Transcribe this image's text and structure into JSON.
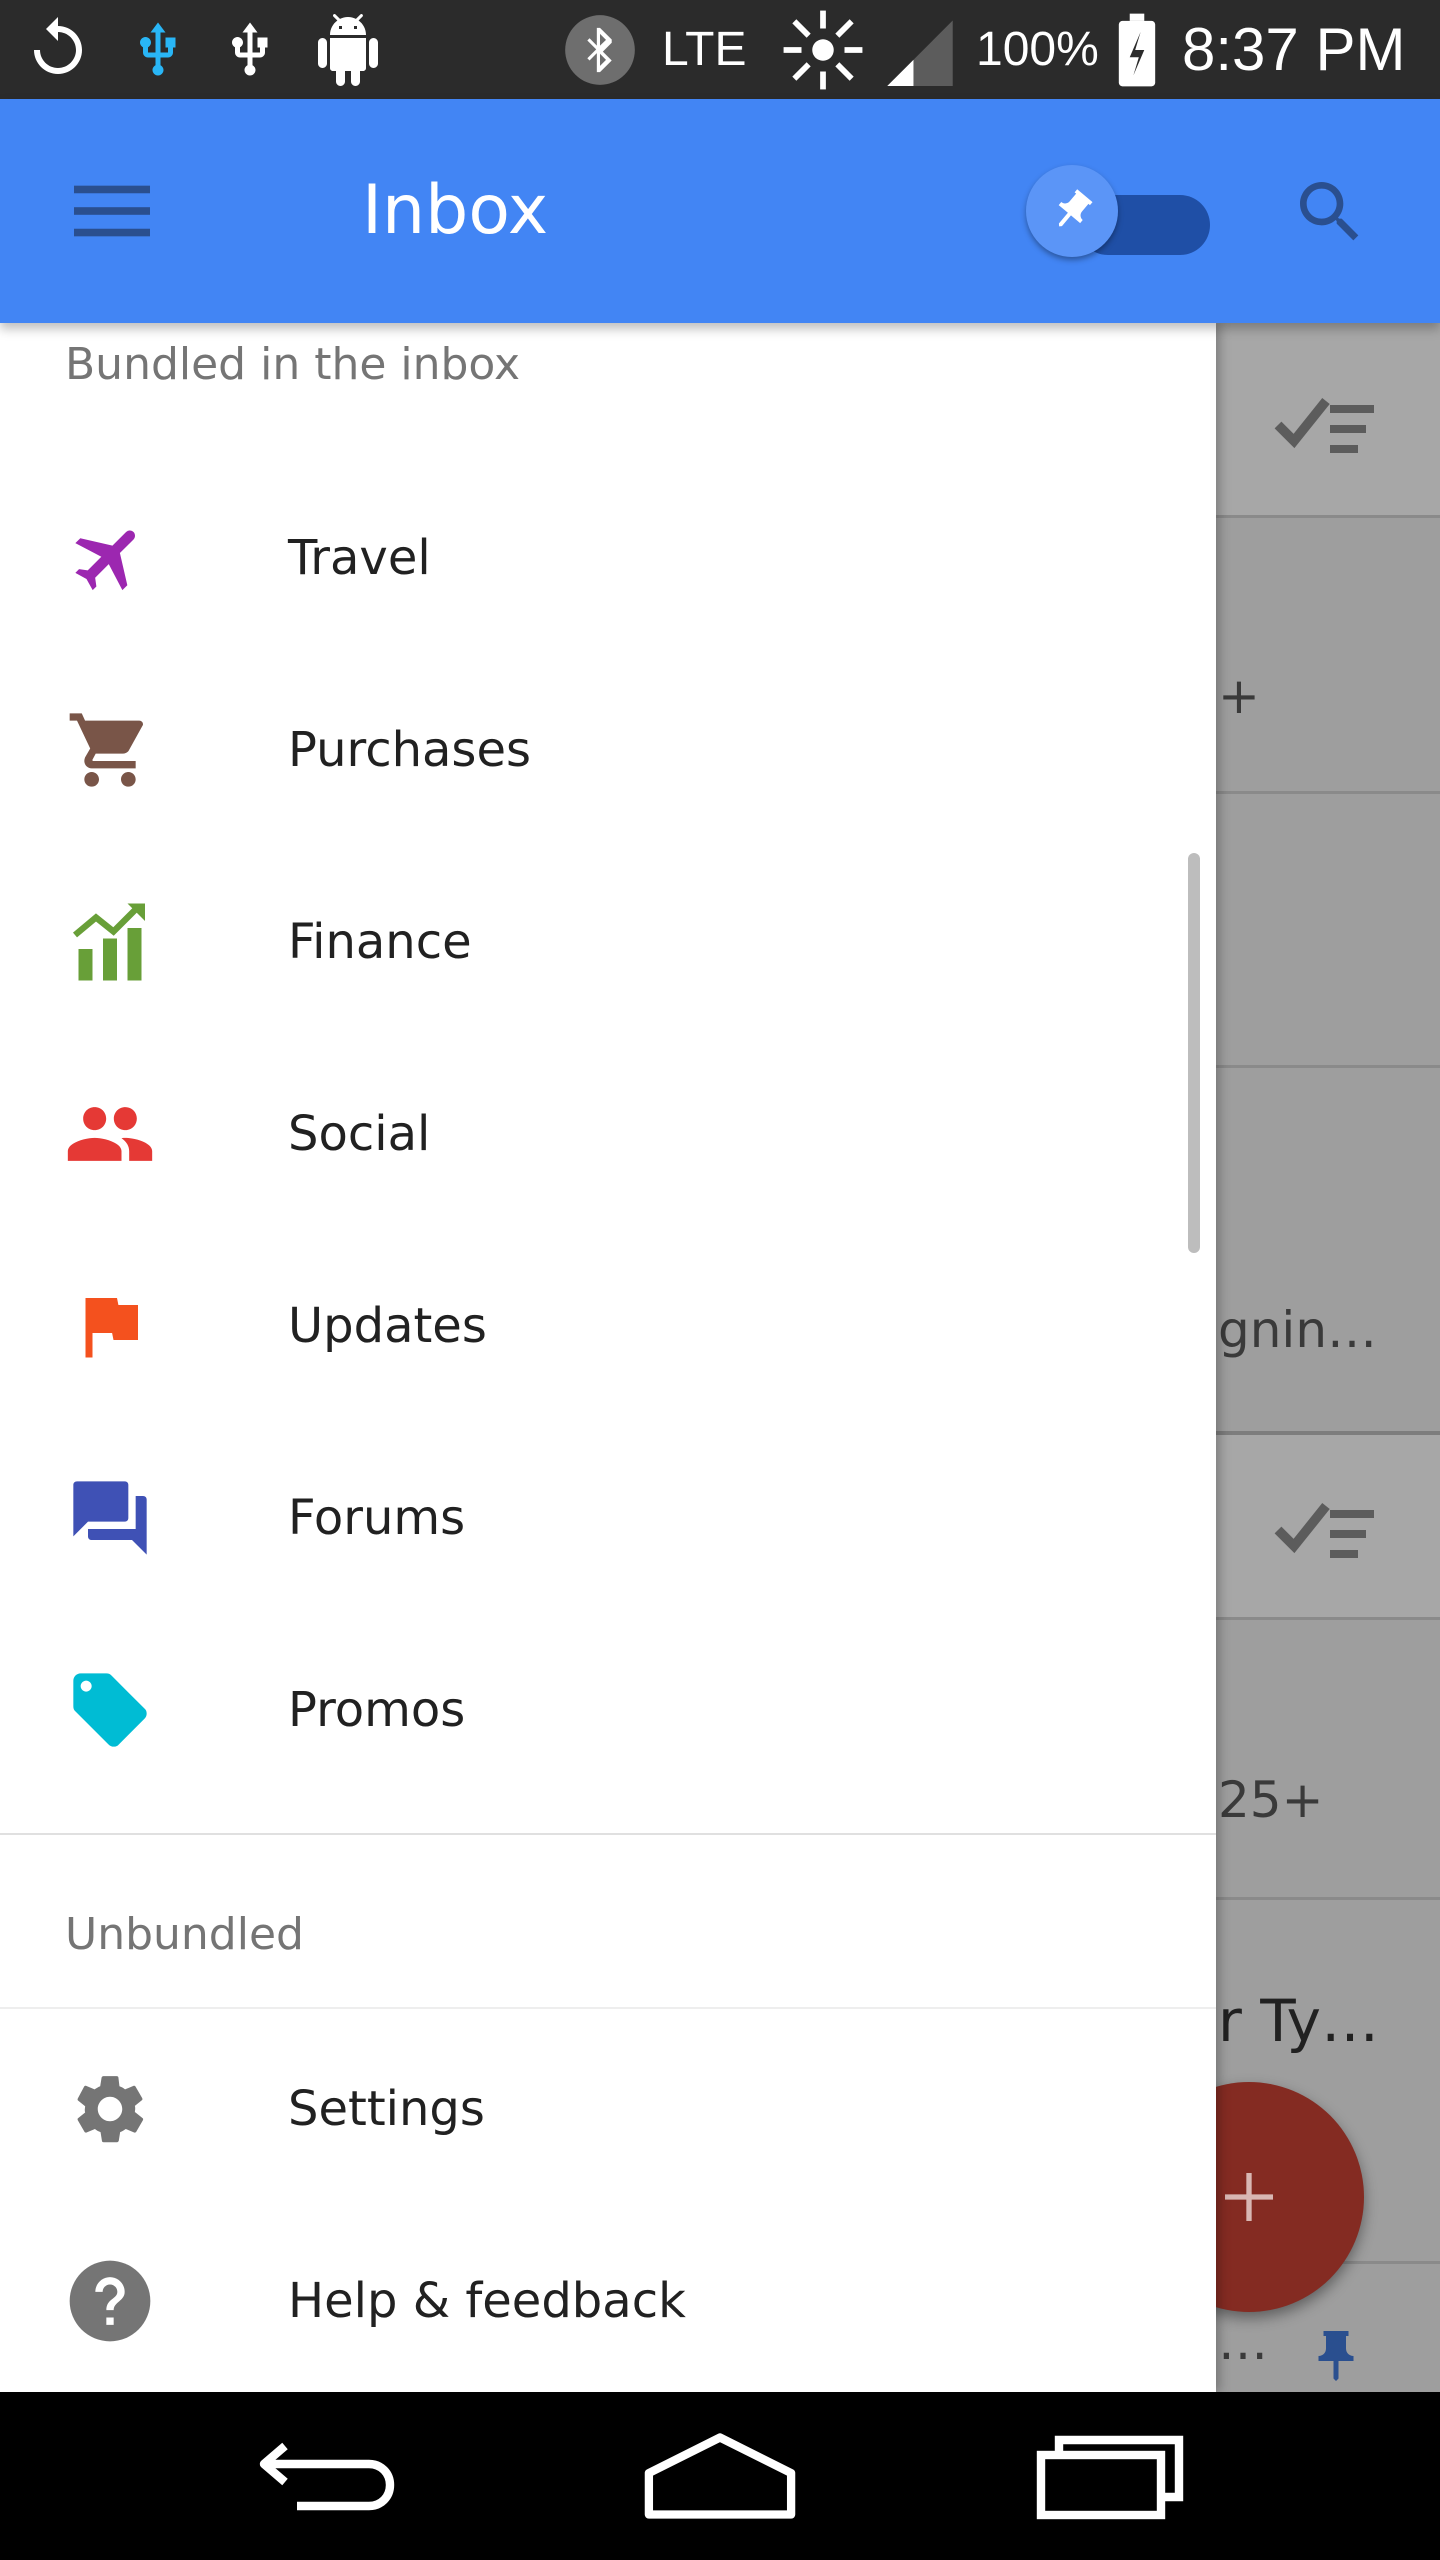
{
  "status_bar": {
    "network": "LTE",
    "battery": "100%",
    "time": "8:37 PM"
  },
  "app_bar": {
    "title": "Inbox",
    "menu_icon": "hamburger-menu-icon",
    "pin_toggle": {
      "icon": "pin-icon",
      "state": "on"
    },
    "search_icon": "search-icon",
    "color": "#4285f4"
  },
  "drawer": {
    "bundled_label": "Bundled in the inbox",
    "bundles": [
      {
        "label": "Travel",
        "icon": "airplane-icon",
        "color": "#9c27b0"
      },
      {
        "label": "Purchases",
        "icon": "cart-icon",
        "color": "#795548"
      },
      {
        "label": "Finance",
        "icon": "finance-chart-icon",
        "color": "#689f38"
      },
      {
        "label": "Social",
        "icon": "people-icon",
        "color": "#e53935"
      },
      {
        "label": "Updates",
        "icon": "flag-icon",
        "color": "#f4511e"
      },
      {
        "label": "Forums",
        "icon": "forum-icon",
        "color": "#3f51b5"
      },
      {
        "label": "Promos",
        "icon": "tag-icon",
        "color": "#00bcd4"
      }
    ],
    "unbundled_label": "Unbundled",
    "footer_items": [
      {
        "label": "Settings",
        "icon": "gear-icon",
        "color": "#757575"
      },
      {
        "label": "Help & feedback",
        "icon": "help-icon",
        "color": "#757575"
      }
    ]
  },
  "background_peek": {
    "snippets": [
      "+",
      "gnin…",
      "25+",
      "r Ty…",
      "…"
    ],
    "fab_icon": "plus-icon",
    "fab_color": "#842b22"
  },
  "nav_bar": {
    "back_icon": "back-icon",
    "home_icon": "home-icon",
    "recents_icon": "recents-icon"
  }
}
